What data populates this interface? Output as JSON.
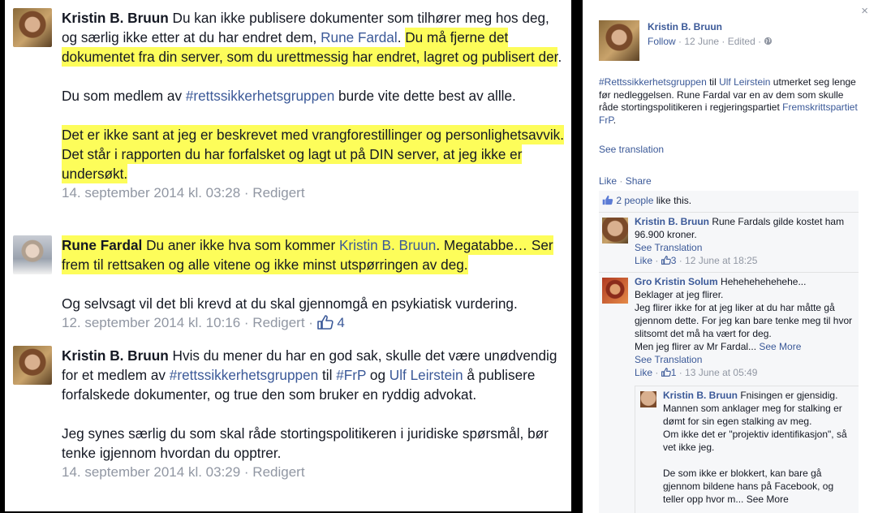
{
  "left": {
    "comments": [
      {
        "author": "Kristin B. Bruun",
        "p1_a": " Du kan ikke publisere dokumenter som tilhører meg hos deg, og særlig ikke etter at du har endret dem, ",
        "p1_link": "Rune Fardal",
        "p1_b": ". ",
        "p1_hl": "Du må fjerne det dokumentet fra din server, som du urettmessig har endret, lagret og publisert der",
        "p1_c": ".",
        "p2_a": "Du som medlem av ",
        "p2_link": "#rettssikkerhetsgruppen",
        "p2_b": " burde vite dette best av allle.",
        "p3_hl": "Det er ikke sant at jeg er beskrevet med vrangforestillinger og personlighetsavvik. Det står i rapporten du har forfalsket og lagt ut på DIN server, at jeg ikke er undersøkt.",
        "meta": "14. september 2014 kl. 03:28 · Redigert"
      },
      {
        "author": "Rune Fardal",
        "p1_hl_a": " Du aner ikke hva som kommer ",
        "p1_link": "Kristin B. Bruun",
        "p1_hl_b": ". Megatabbe… Ser frem til rettsaken og alle vitene og ikke minst utspørringen av deg.",
        "p2": "Og selvsagt vil det bli krevd at du skal gjennomgå en psykiatisk vurdering.",
        "meta": "12. september 2014 kl. 10:16 · Redigert · ",
        "likes": "4"
      },
      {
        "author": "Kristin B. Bruun",
        "p1_a": " Hvis du mener du har en god sak, skulle det være unødvendig for et medlem av ",
        "p1_link1": "#rettssikkerhetsgruppen",
        "p1_b": " til ",
        "p1_link2": "#FrP",
        "p1_c": " og ",
        "p1_link3": "Ulf Leirstein",
        "p1_d": " å publisere forfalskede dokumenter, og true den som bruker en ryddig advokat.",
        "p2": "Jeg synes særlig du som skal råde stortingspolitikeren i juridiske spørsmål, bør tenke igjennom hvordan du opptrer.",
        "meta": "14. september 2014 kl. 03:29 · Redigert"
      }
    ]
  },
  "right": {
    "close": "×",
    "post": {
      "author": "Kristin B. Bruun",
      "follow": "Follow",
      "sub": " · 12 June · Edited · ",
      "text_link1": "#Rettssikkerhetsgruppen",
      "text_a": " til ",
      "text_link2": "Ulf Leirstein",
      "text_b": " utmerket seg lenge før nedleggelsen. Rune Fardal var en av dem som skulle råde stortingspolitikeren i regjeringspartiet ",
      "text_link3": "Fremskrittspartiet FrP",
      "text_c": ".",
      "see_translation": "See translation",
      "like": "Like",
      "share": "Share",
      "liked_count": "2 people",
      "liked_rest": " like this."
    },
    "comments": [
      {
        "author": "Kristin B. Bruun",
        "text": " Rune Fardals gilde kostet ham 96.900 kroner.",
        "see_translation": "See Translation",
        "like": "Like",
        "count": "3",
        "time": " · 12 June at 18:25"
      },
      {
        "author": "Gro Kristin Solum",
        "text_line1": " Hehehehehehehe...",
        "text_rest": "Beklager at jeg flirer.\nJeg flirer ikke for at jeg liker at du har måtte gå gjennom dette. For jeg kan bare tenke meg til hvor slitsomt det må ha vært for deg.\nMen jeg flirer av Mr Fardal... ",
        "see_more": "See More",
        "see_translation": "See Translation",
        "like": "Like",
        "count": "1",
        "time": " · 13 June at 05:49"
      }
    ],
    "reply": {
      "author": "Kristin B. Bruun",
      "text_a": " Fnisingen er gjensidig. Mannen som anklager meg for stalking er dømt for sin egen stalking av meg.\nOm ikke det er \"projektiv identifikasjon\", så vet ikke jeg.",
      "text_b": "De som ikke er blokkert, kan bare gå gjennom bildene hans på Facebook, og teller opp hvor m... ",
      "see_more": "See More"
    }
  }
}
